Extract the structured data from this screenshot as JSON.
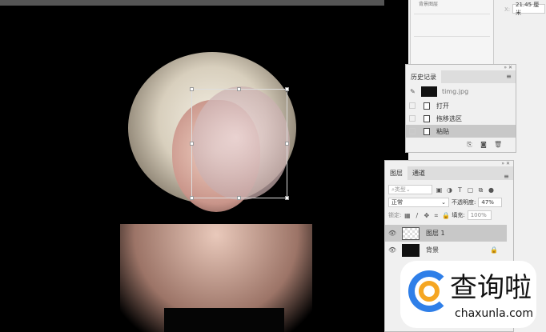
{
  "properties": {
    "label": "背景图层",
    "x_label": "X:",
    "x_value": "21.45 厘米"
  },
  "history": {
    "title": "历史记录",
    "snapshot": "timg.jpg",
    "items": [
      "打开",
      "拖移选区",
      "粘贴"
    ],
    "selected_index": 2
  },
  "layers": {
    "tabs": [
      "图层",
      "通道"
    ],
    "filter_placeholder": "类型",
    "blend_mode": "正常",
    "opacity_label": "不透明度:",
    "opacity_value": "47%",
    "lock_label": "锁定:",
    "fill_label": "填充:",
    "fill_value": "100%",
    "items": [
      {
        "name": "图层 1",
        "selected": true
      },
      {
        "name": "背景",
        "locked": true
      }
    ]
  },
  "watermark": {
    "title": "查询啦",
    "url": "chaxunla.com",
    "colors": {
      "blue": "#2f7fe8",
      "orange": "#f5a623"
    }
  }
}
